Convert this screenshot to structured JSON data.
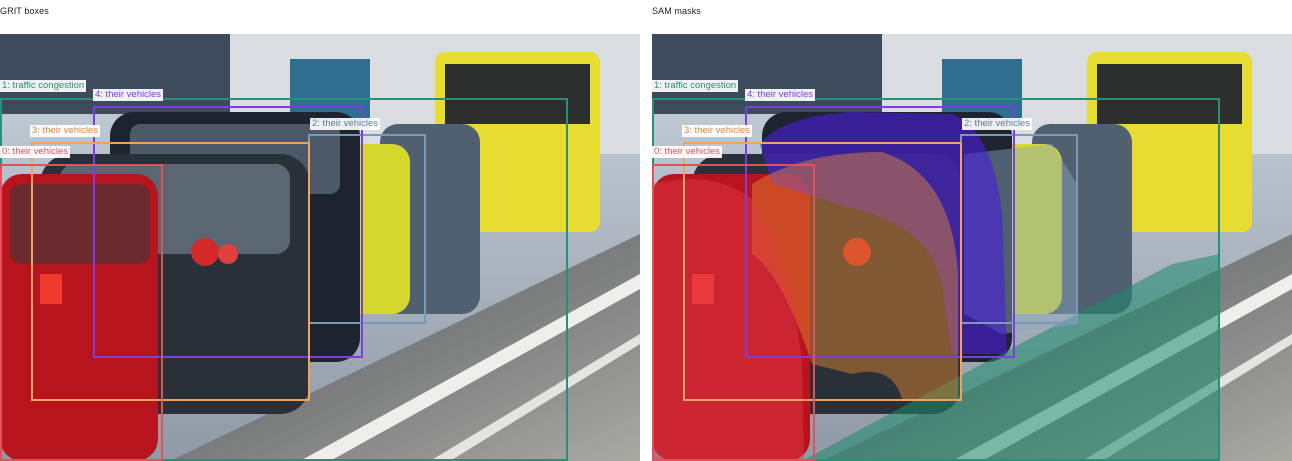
{
  "panels": [
    {
      "title": "GRIT boxes"
    },
    {
      "title": "SAM masks"
    }
  ],
  "colors": {
    "traffic": "#2a8f78",
    "vehicle2": "#7a9ab8",
    "vehicle4": "#7b3fe0",
    "vehicle3": "#f0a260",
    "vehicle0": "#e2505a"
  },
  "detections": [
    {
      "id": 1,
      "label": "1: traffic congestion"
    },
    {
      "id": 4,
      "label": "4: their vehicles"
    },
    {
      "id": 2,
      "label": "2: their vehicles"
    },
    {
      "id": 3,
      "label": "3: their vehicles"
    },
    {
      "id": 0,
      "label": "0: their vehicles"
    }
  ]
}
